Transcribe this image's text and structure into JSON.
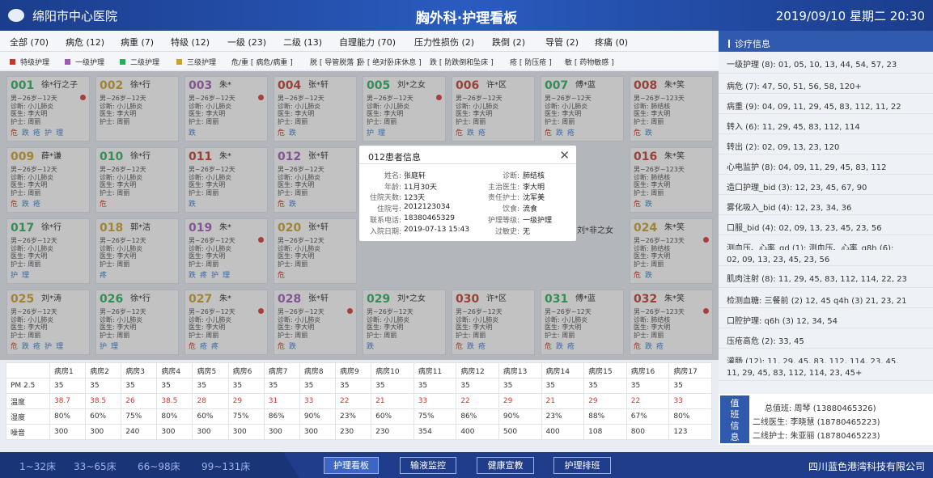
{
  "header": {
    "hospital": "绵阳市中心医院",
    "title": "胸外科·护理看板",
    "datetime": "2019/09/10 星期二 20:30"
  },
  "filters": [
    "全部 (70)",
    "病危 (12)",
    "病重 (7)",
    "特级 (12)",
    "一级 (23)",
    "二级 (13)",
    "自理能力 (70)",
    "压力性损伤 (2)",
    "跌倒 (2)",
    "导管 (2)",
    "疼痛 (0)"
  ],
  "legend": [
    {
      "label": "特级护理",
      "color": "#c0392b"
    },
    {
      "label": "一级护理",
      "color": "#9b59b6"
    },
    {
      "label": "二级护理",
      "color": "#27ae60"
    },
    {
      "label": "三级护理",
      "color": "#c9a227"
    },
    {
      "label": "危/重 [ 病危/病重 ]",
      "color": ""
    },
    {
      "label": "脱 [ 导管脱落 ]",
      "color": ""
    },
    {
      "label": "卧 [ 绝对卧床休息 ]",
      "color": ""
    },
    {
      "label": "跌 [ 防跌倒和坠床 ]",
      "color": ""
    },
    {
      "label": "疮 [ 防压疮 ]",
      "color": ""
    },
    {
      "label": "敏 [ 药物敏感 ]",
      "color": ""
    }
  ],
  "beds": [
    {
      "bed": "001",
      "name": "徐*行之子",
      "color": "#27ae60",
      "heart": true,
      "age": "男~26岁~12天",
      "dx": "诊断: 小儿肺炎",
      "doc": "医生: 李大明",
      "nurse": "护士: 周丽",
      "tags": [
        "危",
        "跌",
        "疮",
        "护",
        "理"
      ]
    },
    {
      "bed": "002",
      "name": "徐*行",
      "color": "#c9a227",
      "heart": false,
      "age": "男~26岁~12天",
      "dx": "诊断: 小儿肺炎",
      "doc": "医生: 李大明",
      "nurse": "护士: 周丽",
      "tags": []
    },
    {
      "bed": "003",
      "name": "朱*",
      "color": "#9b59b6",
      "heart": true,
      "age": "男~26岁~12天",
      "dx": "诊断: 小儿肺炎",
      "doc": "医生: 李大明",
      "nurse": "护士: 周丽",
      "tags": [
        "跌"
      ]
    },
    {
      "bed": "004",
      "name": "张*轩",
      "color": "#c0392b",
      "heart": false,
      "age": "男~26岁~12天",
      "dx": "诊断: 小儿肺炎",
      "doc": "医生: 李大明",
      "nurse": "护士: 周丽",
      "tags": [
        "危",
        "跌"
      ]
    },
    {
      "bed": "005",
      "name": "刘*之女",
      "color": "#27ae60",
      "heart": true,
      "age": "男~26岁~12天",
      "dx": "诊断: 小儿肺炎",
      "doc": "医生: 李大明",
      "nurse": "护士: 周丽",
      "tags": [
        "护",
        "理"
      ]
    },
    {
      "bed": "006",
      "name": "许*区",
      "color": "#c0392b",
      "heart": false,
      "age": "男~26岁~12天",
      "dx": "诊断: 小儿肺炎",
      "doc": "医生: 李大明",
      "nurse": "护士: 周丽",
      "tags": [
        "危",
        "跌",
        "疮"
      ]
    },
    {
      "bed": "007",
      "name": "傅*蓝",
      "color": "#27ae60",
      "heart": false,
      "age": "男~26岁~12天",
      "dx": "诊断: 小儿肺炎",
      "doc": "医生: 李大明",
      "nurse": "护士: 周丽",
      "tags": [
        "危",
        "跌",
        "疮"
      ]
    },
    {
      "bed": "008",
      "name": "朱*笑",
      "color": "#c0392b",
      "heart": false,
      "age": "男~26岁~123天",
      "dx": "诊断: 肺结核",
      "doc": "医生: 李大明",
      "nurse": "护士: 周丽",
      "tags": [
        "危",
        "跌"
      ]
    },
    {
      "bed": "009",
      "name": "薛*谦",
      "color": "#c9a227",
      "heart": false,
      "age": "男~26岁~12天",
      "dx": "诊断: 小儿肺炎",
      "doc": "医生: 李大明",
      "nurse": "护士: 周丽",
      "tags": [
        "危",
        "跌",
        "疮"
      ]
    },
    {
      "bed": "010",
      "name": "徐*行",
      "color": "#27ae60",
      "heart": false,
      "age": "男~26岁~12天",
      "dx": "诊断: 小儿肺炎",
      "doc": "医生: 李大明",
      "nurse": "护士: 周丽",
      "tags": [
        "危"
      ]
    },
    {
      "bed": "011",
      "name": "朱*",
      "color": "#c0392b",
      "heart": false,
      "age": "男~26岁~12天",
      "dx": "诊断: 小儿肺炎",
      "doc": "医生: 李大明",
      "nurse": "护士: 周丽",
      "tags": [
        "跌"
      ]
    },
    {
      "bed": "012",
      "name": "张*轩",
      "color": "#9b59b6",
      "heart": false,
      "age": "男~26岁~12天",
      "dx": "诊断: 小儿肺炎",
      "doc": "医生: 李大明",
      "nurse": "护士: 周丽",
      "tags": [
        "危",
        "跌"
      ]
    },
    {
      "bed": "016",
      "name": "朱*笑",
      "color": "#c0392b",
      "heart": false,
      "age": "男~26岁~123天",
      "dx": "诊断: 肺结核",
      "doc": "医生: 李大明",
      "nurse": "护士: 周丽",
      "tags": [
        "危",
        "跌"
      ]
    },
    {
      "bed": "017",
      "name": "徐*行",
      "color": "#27ae60",
      "heart": false,
      "age": "男~26岁~12天",
      "dx": "诊断: 小儿肺炎",
      "doc": "医生: 李大明",
      "nurse": "护士: 周丽",
      "tags": [
        "护",
        "理"
      ]
    },
    {
      "bed": "018",
      "name": "郭*洁",
      "color": "#c9a227",
      "heart": false,
      "age": "男~26岁~12天",
      "dx": "诊断: 小儿肺炎",
      "doc": "医生: 李大明",
      "nurse": "护士: 周丽",
      "tags": [
        "疼"
      ]
    },
    {
      "bed": "019",
      "name": "朱*",
      "color": "#9b59b6",
      "heart": true,
      "age": "男~26岁~12天",
      "dx": "诊断: 小儿肺炎",
      "doc": "医生: 李大明",
      "nurse": "护士: 周丽",
      "tags": [
        "跌",
        "疼",
        "护",
        "理"
      ]
    },
    {
      "bed": "020",
      "name": "张*轩",
      "color": "#c9a227",
      "heart": false,
      "age": "男~26岁~12天",
      "dx": "诊断: 小儿肺炎",
      "doc": "医生: 李大明",
      "nurse": "护士: 周丽",
      "tags": [
        "危"
      ]
    },
    {
      "bed": "024",
      "name": "朱*笑",
      "color": "#c9a227",
      "heart": true,
      "age": "男~26岁~123天",
      "dx": "诊断: 肺结核",
      "doc": "医生: 李大明",
      "nurse": "护士: 周丽",
      "tags": [
        "危",
        "跌"
      ]
    },
    {
      "bed": "025",
      "name": "刘*涛",
      "color": "#c9a227",
      "heart": false,
      "age": "男~26岁~12天",
      "dx": "诊断: 小儿肺炎",
      "doc": "医生: 李大明",
      "nurse": "护士: 周丽",
      "tags": [
        "危",
        "跌",
        "疮",
        "护",
        "理"
      ]
    },
    {
      "bed": "026",
      "name": "徐*行",
      "color": "#27ae60",
      "heart": false,
      "age": "男~26岁~12天",
      "dx": "诊断: 小儿肺炎",
      "doc": "医生: 李大明",
      "nurse": "护士: 周丽",
      "tags": [
        "护",
        "理"
      ]
    },
    {
      "bed": "027",
      "name": "朱*",
      "color": "#c9a227",
      "heart": true,
      "age": "男~26岁~12天",
      "dx": "诊断: 小儿肺炎",
      "doc": "医生: 李大明",
      "nurse": "护士: 周丽",
      "tags": [
        "危",
        "疮",
        "疼"
      ]
    },
    {
      "bed": "028",
      "name": "张*轩",
      "color": "#9b59b6",
      "heart": true,
      "age": "男~26岁~12天",
      "dx": "诊断: 小儿肺炎",
      "doc": "医生: 李大明",
      "nurse": "护士: 周丽",
      "tags": [
        "危",
        "跌"
      ]
    },
    {
      "bed": "029",
      "name": "刘*之女",
      "color": "#27ae60",
      "heart": false,
      "age": "男~26岁~12天",
      "dx": "诊断: 小儿肺炎",
      "doc": "医生: 李大明",
      "nurse": "护士: 周丽",
      "tags": [
        "跌"
      ]
    },
    {
      "bed": "030",
      "name": "许*区",
      "color": "#c0392b",
      "heart": false,
      "age": "男~26岁~12天",
      "dx": "诊断: 小儿肺炎",
      "doc": "医生: 李大明",
      "nurse": "护士: 周丽",
      "tags": [
        "危",
        "跌",
        "疮"
      ]
    },
    {
      "bed": "031",
      "name": "傅*蓝",
      "color": "#27ae60",
      "heart": false,
      "age": "男~26岁~12天",
      "dx": "诊断: 小儿肺炎",
      "doc": "医生: 李大明",
      "nurse": "护士: 周丽",
      "tags": [
        "危",
        "跌",
        "疮"
      ]
    },
    {
      "bed": "032",
      "name": "朱*笑",
      "color": "#c0392b",
      "heart": true,
      "age": "男~26岁~123天",
      "dx": "诊断: 肺结核",
      "doc": "医生: 李大明",
      "nurse": "护士: 周丽",
      "tags": [
        "危",
        "跌",
        "疮"
      ]
    }
  ],
  "partial_names": {
    "p1": "刘*非之女"
  },
  "env": {
    "rooms": [
      "病房1",
      "病房2",
      "病房3",
      "病房4",
      "病房5",
      "病房6",
      "病房7",
      "病房8",
      "病房9",
      "病房10",
      "病房11",
      "病房12",
      "病房13",
      "病房14",
      "病房15",
      "病房16",
      "病房17"
    ],
    "rows": [
      {
        "label": "PM 2.5",
        "values": [
          "35",
          "35",
          "35",
          "35",
          "35",
          "35",
          "35",
          "35",
          "35",
          "35",
          "35",
          "35",
          "35",
          "35",
          "35",
          "35",
          "35"
        ],
        "red": false
      },
      {
        "label": "温度",
        "values": [
          "38.7",
          "38.5",
          "26",
          "38.5",
          "28",
          "29",
          "31",
          "33",
          "22",
          "21",
          "33",
          "22",
          "29",
          "21",
          "29",
          "22",
          "33"
        ],
        "red": true
      },
      {
        "label": "湿度",
        "values": [
          "80%",
          "60%",
          "75%",
          "80%",
          "60%",
          "75%",
          "86%",
          "90%",
          "23%",
          "60%",
          "75%",
          "86%",
          "90%",
          "23%",
          "88%",
          "67%",
          "80%"
        ],
        "red": false
      },
      {
        "label": "噪音",
        "values": [
          "300",
          "300",
          "240",
          "300",
          "300",
          "300",
          "300",
          "300",
          "230",
          "230",
          "354",
          "400",
          "500",
          "400",
          "108",
          "800",
          "123"
        ],
        "red": false
      }
    ]
  },
  "sidebar": {
    "title": "诊疗信息",
    "rows": [
      "一级护理 (8): 01, 05, 10, 13, 44, 54, 57, 23",
      "病危 (7): 47, 50, 51, 56, 58, 120+",
      "病重 (9): 04, 09, 11, 29, 45, 83, 112, 11, 22",
      "转入 (6): 11, 29, 45, 83, 112, 114",
      "转出 (2): 02, 09, 13, 23, 120",
      "心电监护 (8): 04, 09, 11, 29, 45, 83, 112",
      "造口护理_bid (3): 12, 23, 45, 67, 90",
      "雾化吸入_bid (4): 12, 23, 34, 36",
      "口服_bid (4): 02, 09, 13, 23, 45, 23, 56",
      "测血压、心率_qd (1):     测血压、心率_q8h (6):",
      "02, 09, 13, 23, 45, 23, 56",
      "肌肉注射 (8): 11, 29, 45, 83, 112, 114, 22, 23",
      "检测血糖: 三餐前 (2) 12, 45  q4h (3) 21, 23, 21",
      "口腔护理: q6h (3) 12, 34, 54",
      "压疮高危 (2): 33, 45",
      "灌肠 (12): 11, 29, 45, 83, 112, 114, 23, 45,",
      "11, 29, 45, 83, 112, 114, 23, 45+"
    ]
  },
  "duty": {
    "badge": "值班信息",
    "chief": "总值班: 周琴 (13880465326)",
    "doctor": "二线医生: 李晓慧 (18780465223)",
    "nurse": "二线护士: 朱亚丽 (18780465223)"
  },
  "footer": {
    "ranges": [
      "1~32床",
      "33~65床",
      "66~98床",
      "99~131床"
    ],
    "buttons": [
      "护理看板",
      "输液监控",
      "健康宣教",
      "护理排班"
    ],
    "company": "四川蓝色港湾科技有限公司"
  },
  "modal": {
    "title": "012患者信息",
    "left": [
      [
        "姓名:",
        "张庭轩"
      ],
      [
        "年龄:",
        "11月30天"
      ],
      [
        "住院天数:",
        "123天"
      ],
      [
        "住院号:",
        "2012123034"
      ],
      [
        "联系电话:",
        "18380465329"
      ],
      [
        "入院日期:",
        "2019-07-13 15:43"
      ]
    ],
    "right": [
      [
        "诊断:",
        "肺结核"
      ],
      [
        "主治医生:",
        "李大明"
      ],
      [
        "责任护士:",
        "沈军美"
      ],
      [
        "饮食:",
        "流食"
      ],
      [
        "护理等级:",
        "一级护理"
      ],
      [
        "过敏史:",
        "无"
      ]
    ]
  }
}
